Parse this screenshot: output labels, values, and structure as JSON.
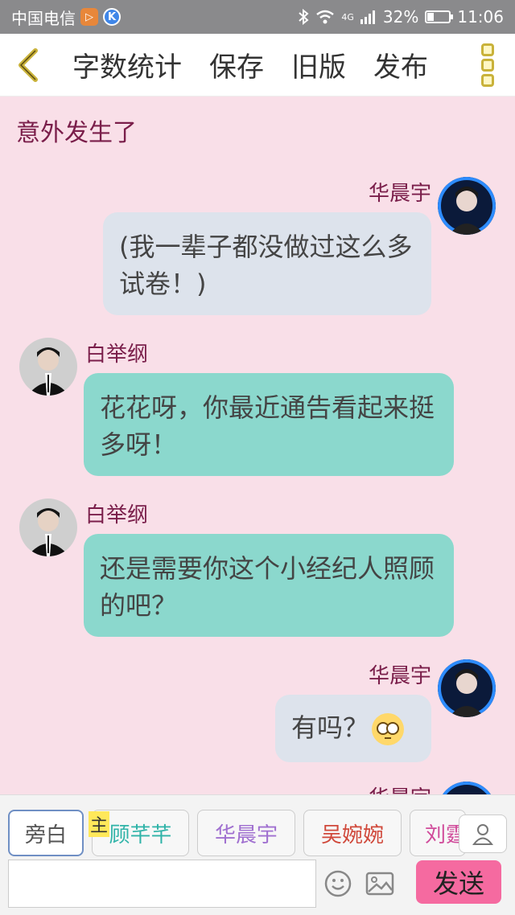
{
  "status_bar": {
    "carrier": "中国电信",
    "network": "4G",
    "battery_percent": "32%",
    "battery_level": 0.32,
    "time": "11:06"
  },
  "toolbar": {
    "items": [
      "字数统计",
      "保存",
      "旧版",
      "发布"
    ]
  },
  "chat": {
    "narration": "意外发生了",
    "messages": [
      {
        "speaker": "华晨宇",
        "text": "(我一辈子都没做过这么多试卷！)",
        "side": "right",
        "color": "gray"
      },
      {
        "speaker": "白举纲",
        "text": "花花呀，你最近通告看起来挺多呀！",
        "side": "left",
        "color": "teal"
      },
      {
        "speaker": "白举纲",
        "text": "还是需要你这个小经纪人照顾的吧？",
        "side": "left",
        "color": "teal"
      },
      {
        "speaker": "华晨宇",
        "text": "有吗？",
        "side": "right",
        "color": "gray",
        "emoji": "flushed-face-emoji"
      },
      {
        "speaker": "华晨宇",
        "side": "right"
      }
    ]
  },
  "roles": {
    "main_tag": "主",
    "items": [
      {
        "label": "旁白",
        "color": "#555555"
      },
      {
        "label": "顾芊芊",
        "color": "#2fb3a8"
      },
      {
        "label": "华晨宇",
        "color": "#a070d0"
      },
      {
        "label": "吴婉婉",
        "color": "#d0483a"
      },
      {
        "label": "刘霆",
        "color": "#d04a9a"
      }
    ]
  },
  "composer": {
    "input_value": "",
    "send_label": "发送"
  },
  "colors": {
    "background": "#f9dfe8",
    "name": "#7a1e4a",
    "bubble_gray": "#dde3ec",
    "bubble_teal": "#8bd8cd",
    "send": "#f56aa0"
  }
}
